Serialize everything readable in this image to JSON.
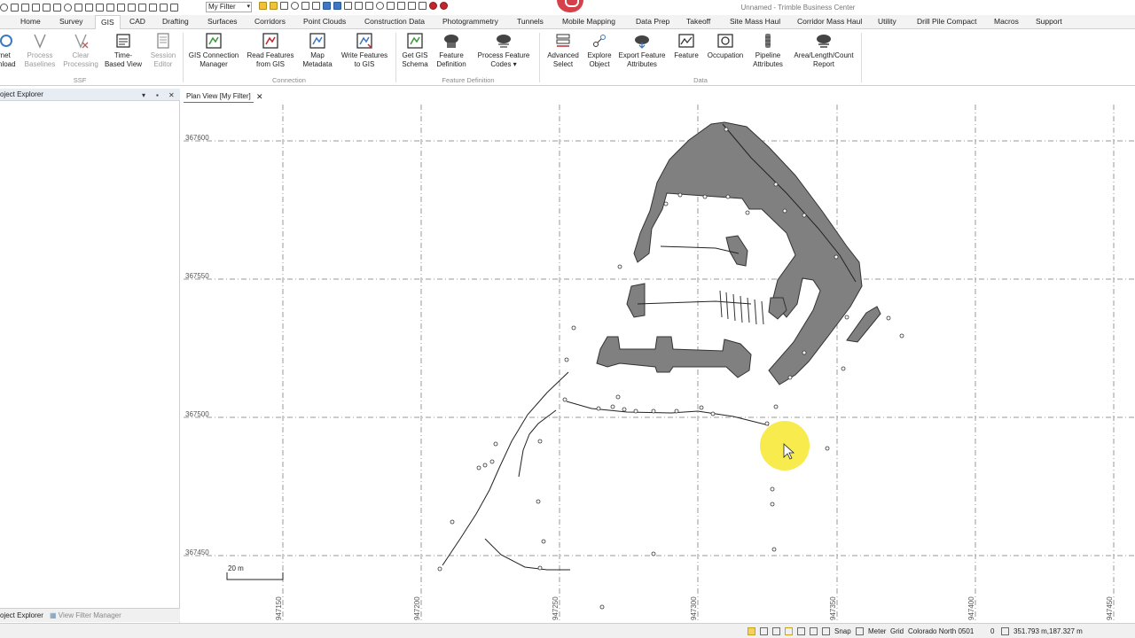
{
  "window": {
    "title": "Unnamed - Trimble Business Center",
    "filter_value": "My Filter"
  },
  "ribbon_tabs": [
    "Home",
    "Survey",
    "GIS",
    "CAD",
    "Drafting",
    "Surfaces",
    "Corridors",
    "Point Clouds",
    "Construction Data",
    "Photogrammetry",
    "Tunnels",
    "Mobile Mapping",
    "Data Prep",
    "Takeoff",
    "Site Mass Haul",
    "Corridor Mass Haul",
    "Utility",
    "Drill Pile Compact",
    "Macros",
    "Support"
  ],
  "active_tab": "GIS",
  "ribbon": {
    "buttons": {
      "internet_download": "rnet\nnload",
      "process_baselines": "Process\nBaselines",
      "clear_processing": "Clear\nProcessing",
      "time_based_view": "Time-\nBased View",
      "session_editor": "Session\nEditor",
      "gis_connection_manager": "GIS Connection\nManager",
      "read_features": "Read Features\nfrom GIS",
      "map_metadata": "Map\nMetadata",
      "write_features": "Write Features\nto GIS",
      "get_gis_schema": "Get GIS\nSchema",
      "feature_definition": "Feature\nDefinition",
      "process_feature_codes": "Process Feature\nCodes ▾",
      "advanced_select": "Advanced\nSelect",
      "explore_object": "Explore\nObject",
      "export_feature_attributes": "Export Feature\nAttributes",
      "feature": "Feature",
      "occupation": "Occupation",
      "pipeline_attributes": "Pipeline\nAttributes",
      "area_length_count": "Area/Length/Count\nReport"
    },
    "groups": {
      "ssf": "SSF",
      "connection": "Connection",
      "feature_definition": "Feature Definition",
      "data": "Data"
    }
  },
  "explorer": {
    "title": "oject Explorer",
    "tabs": {
      "project_explorer": "oject Explorer",
      "view_filter_manager": "View Filter Manager"
    }
  },
  "plan_view": {
    "tab_label": "Plan View [My Filter]",
    "close_glyph": "✕",
    "northing_labels": [
      "367600",
      "367550",
      "367500",
      "367450"
    ],
    "easting_labels": [
      "947150",
      "947200",
      "947250",
      "947300",
      "947350",
      "947400",
      "947450"
    ],
    "scale_label": "20 m"
  },
  "status": {
    "snap": "Snap",
    "units": "Meter",
    "grid": "Grid",
    "coord_system": "Colorado North 0501",
    "zero": "0",
    "coords": "351.793 m,187.327 m"
  },
  "colors": {
    "feature_fill": "#808080",
    "grid_line": "#9a9a9a",
    "highlight": "#f7e93a",
    "accent": "#3c78c3"
  }
}
